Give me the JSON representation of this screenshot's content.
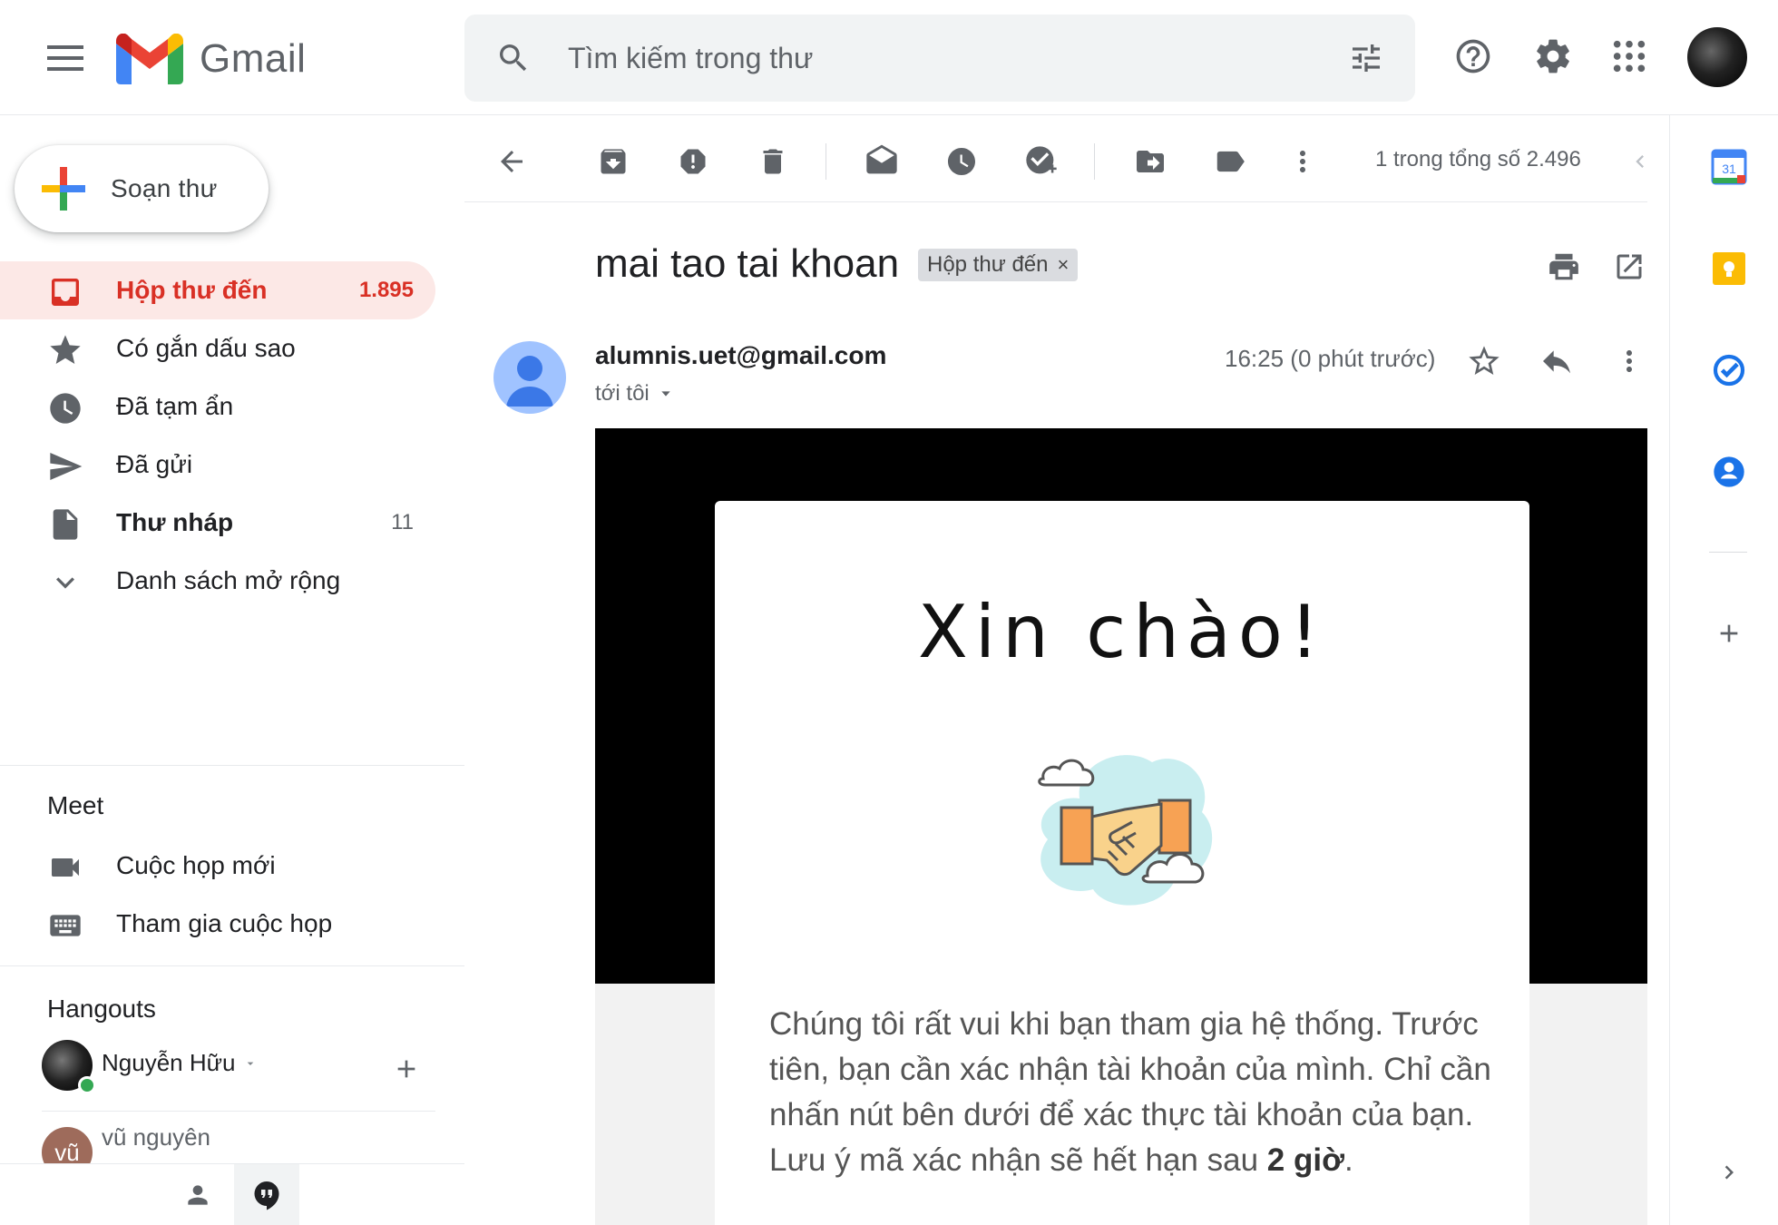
{
  "header": {
    "app_name": "Gmail",
    "search_placeholder": "Tìm kiếm trong thư"
  },
  "sidebar": {
    "compose_label": "Soạn thư",
    "items": [
      {
        "label": "Hộp thư đến",
        "count": "1.895",
        "icon": "inbox-icon"
      },
      {
        "label": "Có gắn dấu sao",
        "count": "",
        "icon": "star-icon"
      },
      {
        "label": "Đã tạm ẩn",
        "count": "",
        "icon": "clock-icon"
      },
      {
        "label": "Đã gửi",
        "count": "",
        "icon": "send-icon"
      },
      {
        "label": "Thư nháp",
        "count": "11",
        "icon": "draft-icon"
      },
      {
        "label": "Danh sách mở rộng",
        "count": "",
        "icon": "chevron-down-icon"
      }
    ],
    "meet": {
      "title": "Meet",
      "new_meeting": "Cuộc họp mới",
      "join_meeting": "Tham gia cuộc họp"
    },
    "hangouts": {
      "title": "Hangouts",
      "user_name": "Nguyễn Hữu",
      "contact_name": "vũ nguyên",
      "contact_initial": "vũ"
    }
  },
  "toolbar": {
    "pagination": "1 trong tổng số 2.496"
  },
  "email": {
    "subject": "mai tao tai khoan",
    "label_chip": "Hộp thư đến",
    "label_chip_close": "×",
    "sender": "alumnis.uet@gmail.com",
    "to": "tới tôi",
    "timestamp": "16:25 (0 phút trước)",
    "greeting": "Xin chào!",
    "body_line1": "Chúng tôi rất vui khi bạn tham gia hệ thống. Trước tiên, bạn cần xác nhận tài khoản của mình. Chỉ cần nhấn nút bên dưới để xác thực tài khoản của bạn.",
    "body_line2_prefix": "Lưu ý mã xác nhận sẽ hết hạn sau ",
    "body_line2_bold": "2 giờ",
    "body_line2_suffix": "."
  },
  "right_panel": {
    "calendar_day": "31"
  },
  "colors": {
    "accent_red": "#d93025",
    "active_bg": "#fce8e6",
    "icon_grey": "#5f6368"
  }
}
